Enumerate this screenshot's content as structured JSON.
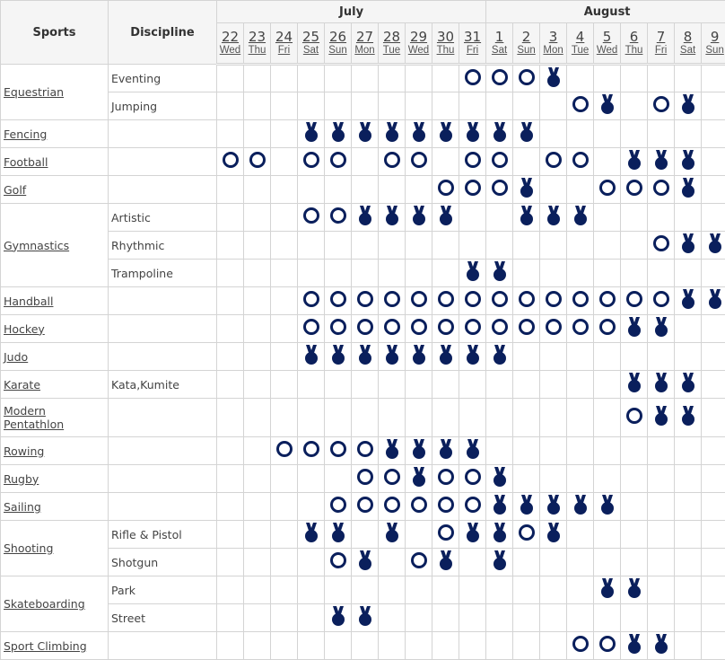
{
  "header": {
    "sports": "Sports",
    "discipline": "Discipline"
  },
  "months": [
    {
      "name": "July",
      "days": 10
    },
    {
      "name": "August",
      "days": 9
    }
  ],
  "days": [
    {
      "d": "22",
      "w": "Wed"
    },
    {
      "d": "23",
      "w": "Thu"
    },
    {
      "d": "24",
      "w": "Fri"
    },
    {
      "d": "25",
      "w": "Sat"
    },
    {
      "d": "26",
      "w": "Sun"
    },
    {
      "d": "27",
      "w": "Mon"
    },
    {
      "d": "28",
      "w": "Tue"
    },
    {
      "d": "29",
      "w": "Wed"
    },
    {
      "d": "30",
      "w": "Thu"
    },
    {
      "d": "31",
      "w": "Fri"
    },
    {
      "d": "1",
      "w": "Sat"
    },
    {
      "d": "2",
      "w": "Sun"
    },
    {
      "d": "3",
      "w": "Mon"
    },
    {
      "d": "4",
      "w": "Tue"
    },
    {
      "d": "5",
      "w": "Wed"
    },
    {
      "d": "6",
      "w": "Thu"
    },
    {
      "d": "7",
      "w": "Fri"
    },
    {
      "d": "8",
      "w": "Sat"
    },
    {
      "d": "9",
      "w": "Sun"
    }
  ],
  "legend": {
    "o": "event-session",
    "m": "medal-event"
  },
  "colors": {
    "icon": "#0a1f5c",
    "grid": "#d4d4d4",
    "header_bg": "#f5f5f5"
  },
  "sports": [
    {
      "name": "Equestrian",
      "rows": [
        {
          "discipline": "Eventing",
          "schedule": ".........ooom......"
        },
        {
          "discipline": "Jumping",
          "schedule": ".............om.om."
        }
      ]
    },
    {
      "name": "Fencing",
      "rows": [
        {
          "discipline": "",
          "schedule": "...mmmmmmmmm......."
        }
      ]
    },
    {
      "name": "Football",
      "rows": [
        {
          "discipline": "",
          "schedule": "oo.oo.oo.oo.oo.mmm."
        }
      ]
    },
    {
      "name": "Golf",
      "rows": [
        {
          "discipline": "",
          "schedule": "........ooom..ooom."
        }
      ]
    },
    {
      "name": "Gymnastics",
      "rows": [
        {
          "discipline": "Artistic",
          "schedule": "...oommmm..mmm....."
        },
        {
          "discipline": "Rhythmic",
          "schedule": "................omm"
        },
        {
          "discipline": "Trampoline",
          "schedule": ".........mm........"
        }
      ]
    },
    {
      "name": "Handball",
      "rows": [
        {
          "discipline": "",
          "schedule": "...oooooooooooooomm"
        }
      ]
    },
    {
      "name": "Hockey",
      "rows": [
        {
          "discipline": "",
          "schedule": "...oooooooooooomm.."
        }
      ]
    },
    {
      "name": "Judo",
      "rows": [
        {
          "discipline": "",
          "schedule": "...mmmmmmmm........"
        }
      ]
    },
    {
      "name": "Karate",
      "rows": [
        {
          "discipline": "Kata,Kumite",
          "schedule": "...............mmm."
        }
      ]
    },
    {
      "name": "Modern Pentathlon",
      "rows": [
        {
          "discipline": "",
          "schedule": "...............omm."
        }
      ]
    },
    {
      "name": "Rowing",
      "rows": [
        {
          "discipline": "",
          "schedule": "..oooommmm........."
        }
      ]
    },
    {
      "name": "Rugby",
      "rows": [
        {
          "discipline": "",
          "schedule": ".....oomoom........"
        }
      ]
    },
    {
      "name": "Sailing",
      "rows": [
        {
          "discipline": "",
          "schedule": "....oooooommmmm...."
        }
      ]
    },
    {
      "name": "Shooting",
      "rows": [
        {
          "discipline": "Rifle & Pistol",
          "schedule": "...mm.m.ommom......"
        },
        {
          "discipline": "Shotgun",
          "schedule": "....om.om.m........"
        }
      ]
    },
    {
      "name": "Skateboarding",
      "rows": [
        {
          "discipline": "Park",
          "schedule": "..............mm..."
        },
        {
          "discipline": "Street",
          "schedule": "....mm............."
        }
      ]
    },
    {
      "name": "Sport Climbing",
      "rows": [
        {
          "discipline": "",
          "schedule": ".............oomm.."
        }
      ]
    }
  ]
}
